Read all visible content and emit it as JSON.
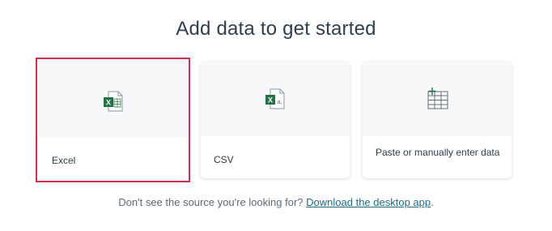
{
  "title": "Add data to get started",
  "cards": [
    {
      "label": "Excel",
      "icon": "excel-file-icon",
      "selected": true
    },
    {
      "label": "CSV",
      "icon": "csv-file-icon",
      "selected": false
    },
    {
      "label": "Paste or manually enter data",
      "icon": "table-grid-icon",
      "selected": false
    }
  ],
  "footer": {
    "text": "Don't see the source you're looking for?",
    "link": "Download the desktop app",
    "period": "."
  },
  "colors": {
    "selected_border": "#d1304e",
    "excel_green": "#217346",
    "link": "#1f6e86"
  }
}
